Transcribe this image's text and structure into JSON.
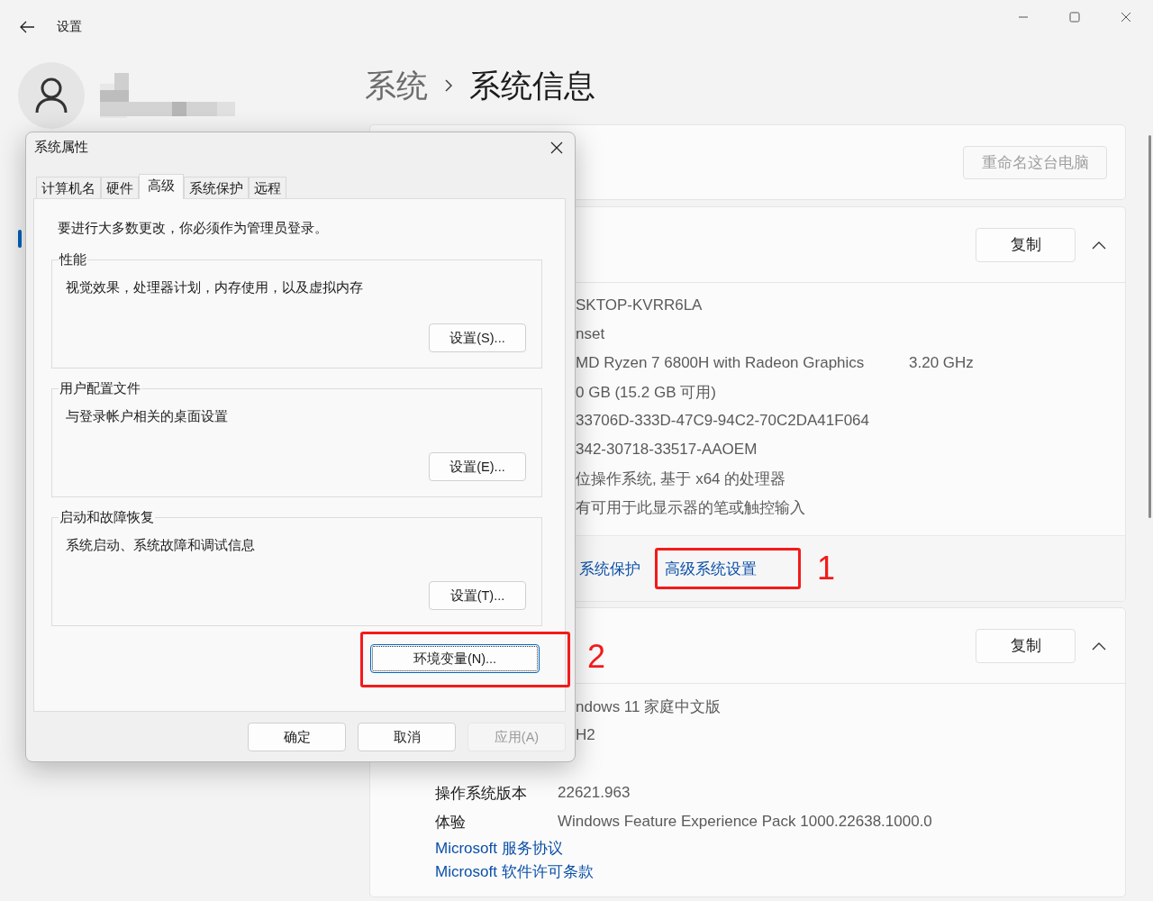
{
  "window": {
    "title": "设置"
  },
  "breadcrumb": [
    "系统",
    "系统信息"
  ],
  "device_card": {
    "rename_button": {
      "label": "重命名这台电脑",
      "disabled": true
    }
  },
  "device_specs": {
    "copy_button": "复制",
    "expanded": true,
    "rows": [
      {
        "value": "SKTOP-KVRR6LA"
      },
      {
        "value": "nset"
      },
      {
        "value": "MD Ryzen 7 6800H with Radeon Graphics",
        "extra": "3.20 GHz"
      },
      {
        "value": "0 GB (15.2 GB 可用)"
      },
      {
        "value": "33706D-333D-47C9-94C2-70C2DA41F064"
      },
      {
        "value": "342-30718-33517-AAOEM"
      },
      {
        "value": "位操作系统, 基于 x64 的处理器"
      },
      {
        "value": "有可用于此显示器的笔或触控输入"
      }
    ],
    "related_links": [
      {
        "label": "系统保护"
      },
      {
        "label": "高级系统设置",
        "annotation": "1"
      }
    ]
  },
  "windows_specs": {
    "copy_button": "复制",
    "expanded": true,
    "rows": [
      {
        "value": "ndows 11 家庭中文版"
      },
      {
        "value": "H2"
      },
      {
        "label": "操作系统版本",
        "value": "22621.963"
      },
      {
        "label": "体验",
        "value": "Windows Feature Experience Pack 1000.22638.1000.0"
      }
    ],
    "links": [
      "Microsoft 服务协议",
      "Microsoft 软件许可条款"
    ]
  },
  "dialog": {
    "title": "系统属性",
    "tabs": [
      {
        "label": "计算机名",
        "selected": false
      },
      {
        "label": "硬件",
        "selected": false
      },
      {
        "label": "高级",
        "selected": true
      },
      {
        "label": "系统保护",
        "selected": false
      },
      {
        "label": "远程",
        "selected": false
      }
    ],
    "notice": "要进行大多数更改，你必须作为管理员登录。",
    "groups": [
      {
        "title": "性能",
        "description": "视觉效果，处理器计划，内存使用，以及虚拟内存",
        "button": "设置(S)..."
      },
      {
        "title": "用户配置文件",
        "description": "与登录帐户相关的桌面设置",
        "button": "设置(E)..."
      },
      {
        "title": "启动和故障恢复",
        "description": "系统启动、系统故障和调试信息",
        "button": "设置(T)..."
      }
    ],
    "env_button": {
      "label": "环境变量(N)...",
      "focused": true,
      "annotation": "2"
    },
    "buttons": [
      {
        "label": "确定",
        "disabled": false
      },
      {
        "label": "取消",
        "disabled": false
      },
      {
        "label": "应用(A)",
        "disabled": true
      }
    ]
  }
}
